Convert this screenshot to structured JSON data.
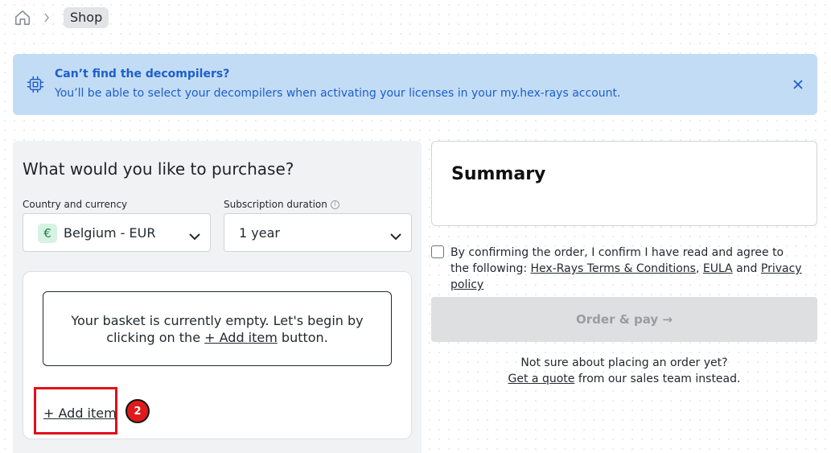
{
  "breadcrumb": {
    "home_icon": "home-icon",
    "separator_icon": "chevron-right-icon",
    "current": "Shop"
  },
  "banner": {
    "icon": "chip-icon",
    "title": "Can’t find the decompilers?",
    "text": "You’ll be able to select your decompilers when activating your licenses in your my.hex-rays account.",
    "close_icon": "close-icon",
    "color": "#1d5fc7"
  },
  "purchase": {
    "heading": "What would you like to purchase?",
    "country_label": "Country and currency",
    "country_value": "Belgium - EUR",
    "currency_symbol": "€",
    "duration_label": "Subscription duration",
    "duration_info_icon": "info-icon",
    "duration_value": "1 year",
    "basket": {
      "empty_line1": "Your basket is currently empty. Let's begin by",
      "empty_pre": "clicking on the ",
      "empty_link": "+ Add item",
      "empty_post": " button."
    },
    "add_item_label": "+ Add item",
    "step_badge": "2"
  },
  "summary": {
    "title": "Summary",
    "consent_pre": "By confirming the order, I confirm I have read and agree to the following: ",
    "terms_link": "Hex-Rays Terms & Conditions",
    "comma": ", ",
    "eula_link": "EULA",
    "and_text": " and ",
    "privacy_link": "Privacy policy",
    "order_button": "Order & pay →",
    "quote_question": "Not sure about placing an order yet?",
    "quote_link": "Get a quote",
    "quote_rest": " from our sales team instead."
  }
}
